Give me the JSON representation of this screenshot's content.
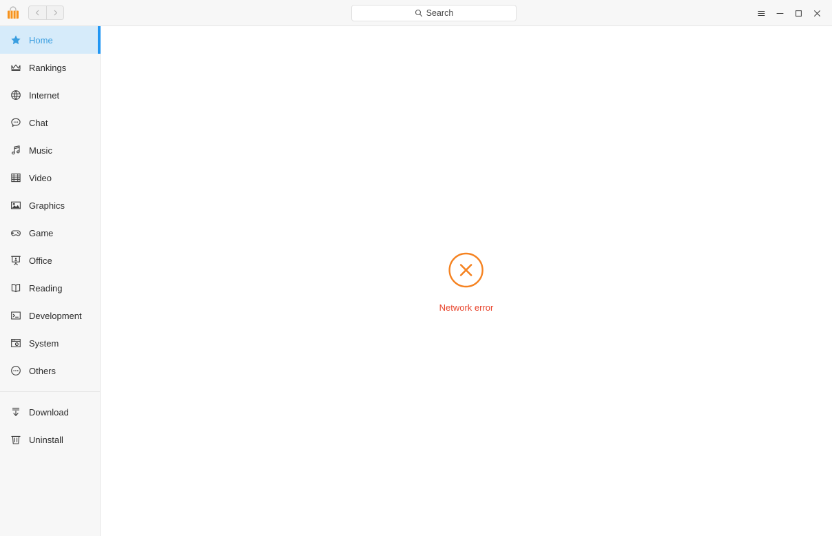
{
  "app": {
    "logo_icon": "shopping-bag-icon",
    "accent_color": "#2196f3",
    "brand_color": "#f58220"
  },
  "titlebar": {
    "nav_back": {
      "icon": "chevron-left-icon",
      "label": "Back"
    },
    "nav_forward": {
      "icon": "chevron-right-icon",
      "label": "Forward"
    },
    "search": {
      "icon": "search-icon",
      "placeholder": "Search",
      "value": ""
    },
    "menu_button": {
      "icon": "hamburger-menu-icon",
      "label": "Menu"
    },
    "minimize_button": {
      "icon": "minimize-icon",
      "label": "Minimize"
    },
    "maximize_button": {
      "icon": "maximize-icon",
      "label": "Maximize"
    },
    "close_button": {
      "icon": "close-icon",
      "label": "Close"
    }
  },
  "sidebar": {
    "items": [
      {
        "label": "Home",
        "icon": "star-icon",
        "active": true
      },
      {
        "label": "Rankings",
        "icon": "crown-icon",
        "active": false
      },
      {
        "label": "Internet",
        "icon": "globe-icon",
        "active": false
      },
      {
        "label": "Chat",
        "icon": "chat-bubble-icon",
        "active": false
      },
      {
        "label": "Music",
        "icon": "music-note-icon",
        "active": false
      },
      {
        "label": "Video",
        "icon": "film-strip-icon",
        "active": false
      },
      {
        "label": "Graphics",
        "icon": "image-icon",
        "active": false
      },
      {
        "label": "Game",
        "icon": "gamepad-icon",
        "active": false
      },
      {
        "label": "Office",
        "icon": "presentation-icon",
        "active": false
      },
      {
        "label": "Reading",
        "icon": "open-book-icon",
        "active": false
      },
      {
        "label": "Development",
        "icon": "terminal-icon",
        "active": false
      },
      {
        "label": "System",
        "icon": "system-window-icon",
        "active": false
      },
      {
        "label": "Others",
        "icon": "ellipsis-circle-icon",
        "active": false
      }
    ],
    "footer_items": [
      {
        "label": "Download",
        "icon": "download-icon"
      },
      {
        "label": "Uninstall",
        "icon": "trash-icon"
      }
    ]
  },
  "main": {
    "error": {
      "icon": "error-circle-x-icon",
      "message": "Network error",
      "color": "#e8442c"
    }
  }
}
